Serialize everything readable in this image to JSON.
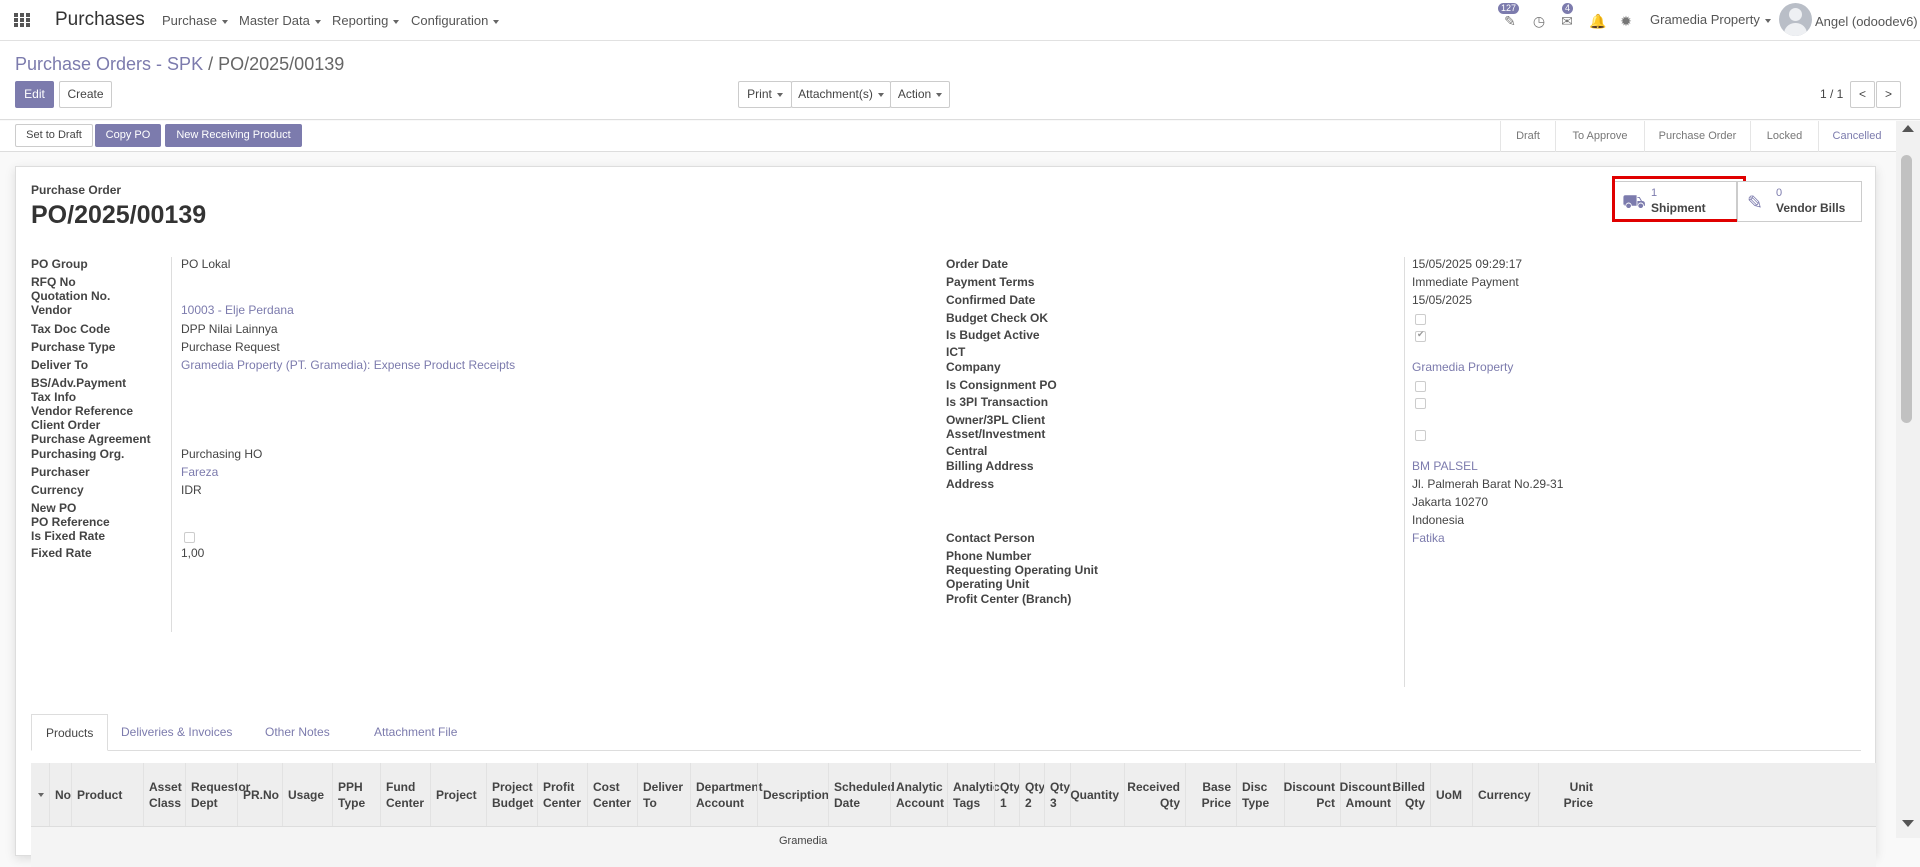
{
  "nav": {
    "app_title": "Purchases",
    "menus": [
      "Purchase",
      "Master Data",
      "Reporting",
      "Configuration"
    ],
    "activity_count": "127",
    "message_count": "4",
    "company": "Gramedia Property",
    "user": "Angel (odoodev6)"
  },
  "control": {
    "breadcrumb_parent": "Purchase Orders - SPK",
    "breadcrumb_sep": "/",
    "breadcrumb_current": "PO/2025/00139",
    "edit_label": "Edit",
    "create_label": "Create",
    "print_label": "Print",
    "attachment_label": "Attachment(s)",
    "action_label": "Action",
    "pager": "1 / 1",
    "prev": "<",
    "next": ">"
  },
  "statusbar": {
    "buttons": [
      "Set to Draft",
      "Copy PO",
      "New Receiving Product"
    ],
    "stages": [
      "Draft",
      "To Approve",
      "Purchase Order",
      "Locked",
      "Cancelled"
    ],
    "active_stage": "Cancelled"
  },
  "smart_buttons": [
    {
      "count": "1",
      "label": "Shipment",
      "icon": "truck-icon"
    },
    {
      "count": "0",
      "label": "Vendor Bills",
      "icon": "pencil-square-icon"
    }
  ],
  "header": {
    "doc_type": "Purchase Order",
    "name": "PO/2025/00139"
  },
  "left_fields": [
    {
      "label": "PO Group",
      "value": "PO Lokal",
      "link": false
    },
    {
      "label": "RFQ No",
      "value": "",
      "link": false
    },
    {
      "label": "Quotation No.",
      "value": "",
      "link": false
    },
    {
      "label": "Vendor",
      "value": "10003 - Elje Perdana",
      "link": true
    },
    {
      "label": "Tax Doc Code",
      "value": "DPP Nilai Lainnya",
      "link": false
    },
    {
      "label": "Purchase Type",
      "value": "Purchase Request",
      "link": false
    },
    {
      "label": "Deliver To",
      "value": "Gramedia Property (PT. Gramedia): Expense Product Receipts",
      "link": true
    },
    {
      "label": "BS/Adv.Payment",
      "value": "",
      "link": false
    },
    {
      "label": "Tax Info",
      "value": "",
      "link": false
    },
    {
      "label": "Vendor Reference",
      "value": "",
      "link": false
    },
    {
      "label": "Client Order",
      "value": "",
      "link": false
    },
    {
      "label": "Purchase Agreement",
      "value": "",
      "link": false
    },
    {
      "label": "Purchasing Org.",
      "value": "Purchasing HO",
      "link": false
    },
    {
      "label": "Purchaser",
      "value": "Fareza",
      "link": true
    },
    {
      "label": "Currency",
      "value": "IDR",
      "link": false
    },
    {
      "label": "New PO",
      "value": "",
      "link": false
    },
    {
      "label": "PO Reference",
      "value": "",
      "link": false
    },
    {
      "label": "Is Fixed Rate",
      "value": "",
      "link": false,
      "checkbox": false
    },
    {
      "label": "Fixed Rate",
      "value": "1,00",
      "link": false
    }
  ],
  "right_fields": [
    {
      "label": "Order Date",
      "value": "15/05/2025 09:29:17",
      "link": false
    },
    {
      "label": "Payment Terms",
      "value": "Immediate Payment",
      "link": false
    },
    {
      "label": "Confirmed Date",
      "value": "15/05/2025",
      "link": false
    },
    {
      "label": "Budget Check OK",
      "value": "",
      "link": false,
      "checkbox": false
    },
    {
      "label": "Is Budget Active",
      "value": "",
      "link": false,
      "checkbox": true
    },
    {
      "label": "ICT",
      "value": "",
      "link": false
    },
    {
      "label": "Company",
      "value": "Gramedia Property",
      "link": true
    },
    {
      "label": "Is Consignment PO",
      "value": "",
      "link": false,
      "checkbox": false
    },
    {
      "label": "Is 3PI Transaction",
      "value": "",
      "link": false,
      "checkbox": false
    },
    {
      "label": "Owner/3PL Client",
      "value": "",
      "link": false
    },
    {
      "label": "Asset/Investment",
      "value": "",
      "link": false,
      "checkbox": false
    },
    {
      "label": "Central",
      "value": "",
      "link": false
    },
    {
      "label": "Billing Address",
      "value": "BM PALSEL",
      "link": true
    },
    {
      "label": "Address",
      "value": "Jl. Palmerah Barat No.29-31",
      "link": false
    },
    {
      "label": "",
      "value": "Jakarta  10270",
      "link": false
    },
    {
      "label": "",
      "value": "Indonesia",
      "link": false
    },
    {
      "label": "Contact Person",
      "value": "Fatika",
      "link": true
    },
    {
      "label": "Phone Number",
      "value": "",
      "link": false
    },
    {
      "label": "Requesting Operating Unit",
      "value": "",
      "link": false
    },
    {
      "label": "Operating Unit",
      "value": "",
      "link": false
    },
    {
      "label": "Profit Center (Branch)",
      "value": "",
      "link": false
    }
  ],
  "tabs": [
    "Products",
    "Deliveries & Invoices",
    "Other Notes",
    "Attachment File"
  ],
  "active_tab": "Products",
  "table": {
    "columns": [
      "No",
      "Product",
      "Asset Class",
      "Requestor Dept",
      "PR.No",
      "Usage",
      "PPH Type",
      "Fund Center",
      "Project",
      "Project Budget",
      "Profit Center",
      "Cost Center",
      "Deliver To",
      "Department Account",
      "Description",
      "Scheduled Date",
      "Analytic Account",
      "Analytic Tags",
      "Qty 1",
      "Qty 2",
      "Qty 3",
      "Quantity",
      "Received Qty",
      "Base Price",
      "Disc Type",
      "Discount Pct",
      "Discount Amount",
      "Billed Qty",
      "UoM",
      "Currency",
      "Unit Price"
    ],
    "first_row_partial": "Gramedia"
  }
}
